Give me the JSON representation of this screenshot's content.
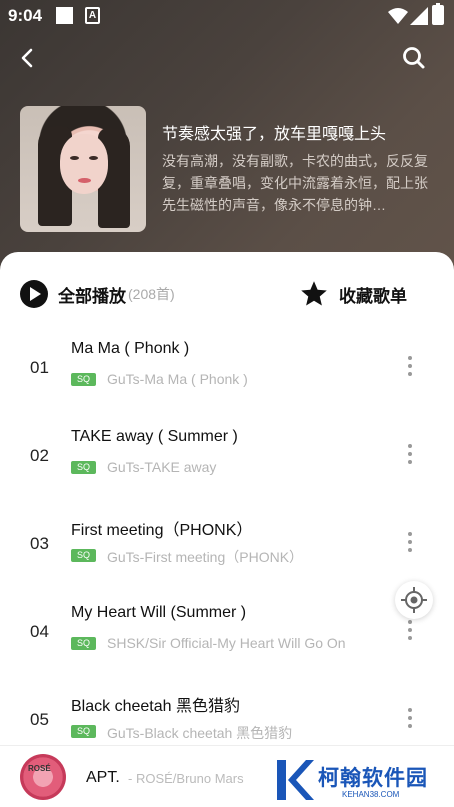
{
  "status_bar": {
    "time": "9:04"
  },
  "playlist": {
    "title": "节奏感太强了，放车里嘎嘎上头",
    "description": "没有高潮，没有副歌，卡农的曲式，反反复复，重章叠唱，变化中流露着永恒，配上张先生磁性的声音，像永不停息的钟…"
  },
  "actions": {
    "play_all_label": "全部播放",
    "play_all_count": "(208首)",
    "collect_label": "收藏歌单"
  },
  "songs": [
    {
      "num": "01",
      "title": "Ma Ma ( Phonk )",
      "quality": "SQ",
      "subtitle": "GuTs-Ma Ma ( Phonk )"
    },
    {
      "num": "02",
      "title": "TAKE away ( Summer )",
      "quality": "SQ",
      "subtitle": "GuTs-TAKE away"
    },
    {
      "num": "03",
      "title": "First meeting（PHONK）",
      "quality": "SQ",
      "subtitle": "GuTs-First meeting（PHONK）"
    },
    {
      "num": "04",
      "title": "My Heart Will (Summer )",
      "quality": "SQ",
      "subtitle": "SHSK/Sir Official-My Heart Will Go On"
    },
    {
      "num": "05",
      "title": "Black cheetah 黑色猎豹",
      "quality": "SQ",
      "subtitle": "GuTs-Black cheetah 黑色猎豹"
    }
  ],
  "mini_player": {
    "title": "APT.",
    "artist": "- ROSÉ/Bruno Mars",
    "cover_text": "ROSÉ"
  },
  "watermark": {
    "brand": "柯翰软件园",
    "url": "KEHAN38.COM"
  },
  "colors": {
    "header_bg": "#4a423d",
    "sq_badge": "#5cb85c",
    "watermark": "#1a56b8"
  },
  "icons": [
    "back-icon",
    "search-icon",
    "play-circle-icon",
    "star-icon",
    "more-vertical-icon",
    "locate-icon"
  ]
}
